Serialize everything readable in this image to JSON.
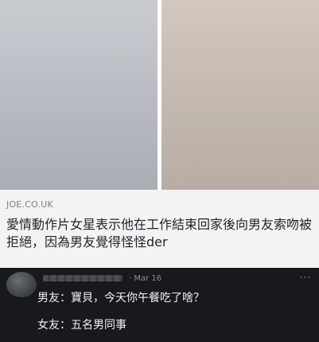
{
  "article": {
    "source": "JOE.CO.UK",
    "headline": "愛情動作片女星表示他在工作結束回家後向男友索吻被拒絕，因為男友覺得怪怪der"
  },
  "post": {
    "date": "· Mar 16",
    "more": "···",
    "line1": "男友：寶貝，今天你午餐吃了啥？",
    "line2": "女友：五名男同事"
  },
  "colors": {
    "card_bg": "#f3f3f4",
    "post_bg": "#17191c",
    "headline_text": "#1f2328",
    "post_text": "#f2f2f2"
  }
}
